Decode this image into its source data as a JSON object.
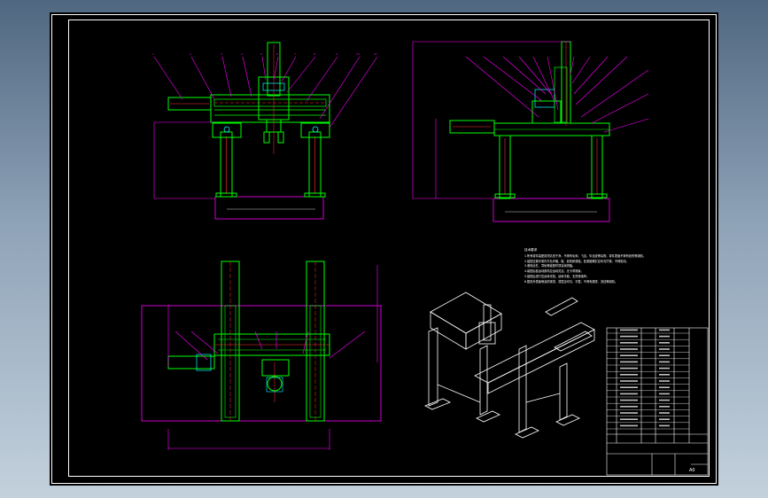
{
  "drawing": {
    "notes_title": "技术要求",
    "notes_lines": [
      "1.所有零件装配前须清洗干净，不得有毛刺、飞边、氧化皮等杂物，零件表面不得有划伤等缺陷。",
      "2.装配过程中零件不允许磕、碰、划伤和锈蚀，各紧固螺钉应均匀拧紧，不得松动。",
      "3.滚珠丝杠、导轨等装配时须涂润滑脂。",
      "4.装配后各运动部件应运动灵活，无卡滞现象。",
      "5.装配后进行空运转试验，运转平稳，无异常噪声。",
      "6.整机外表面喷涂防锈漆，漆层应均匀、平整，不得有漏漆、流挂等缺陷。"
    ],
    "scale_text": "A0"
  },
  "palette": {
    "frame": "#ffffff",
    "part": "#00ff00",
    "leader": "#ff00ff",
    "center": "#ff3030",
    "cyan": "#00ffff",
    "yellow": "#ffff00"
  }
}
